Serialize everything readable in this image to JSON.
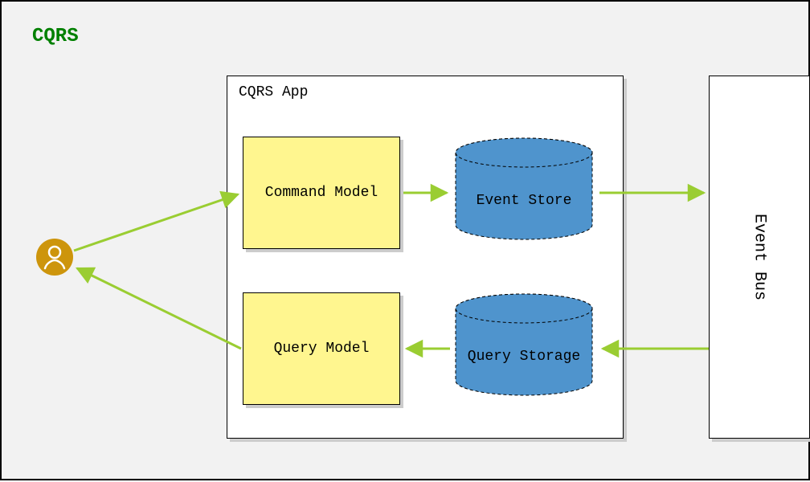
{
  "title": "CQRS",
  "app": {
    "label": "CQRS App"
  },
  "eventBus": {
    "label": "Event Bus"
  },
  "commandModel": {
    "label": "Command Model"
  },
  "queryModel": {
    "label": "Query Model"
  },
  "eventStore": {
    "label": "Event Store"
  },
  "queryStorage": {
    "label": "Query Storage"
  },
  "nodes": [
    {
      "id": "user",
      "type": "actor"
    },
    {
      "id": "command-model",
      "type": "box"
    },
    {
      "id": "query-model",
      "type": "box"
    },
    {
      "id": "event-store",
      "type": "cylinder"
    },
    {
      "id": "query-storage",
      "type": "cylinder"
    },
    {
      "id": "event-bus",
      "type": "container"
    }
  ],
  "edges": [
    {
      "from": "user",
      "to": "command-model"
    },
    {
      "from": "command-model",
      "to": "event-store"
    },
    {
      "from": "event-store",
      "to": "event-bus"
    },
    {
      "from": "event-bus",
      "to": "query-storage"
    },
    {
      "from": "query-storage",
      "to": "query-model"
    },
    {
      "from": "query-model",
      "to": "user"
    }
  ],
  "colors": {
    "title": "#008000",
    "arrow": "#9ACD32",
    "box": "#FFF68F",
    "cylinder": "#4F94CD",
    "actor": "#CD950C"
  }
}
